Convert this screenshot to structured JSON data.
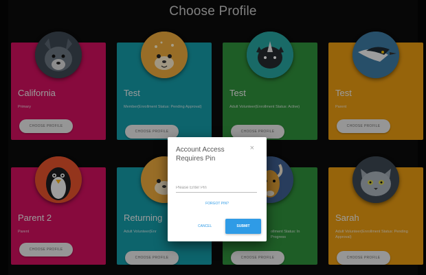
{
  "page": {
    "title": "Choose Profile"
  },
  "profiles": [
    {
      "name": "California",
      "role": "Primary",
      "button": "CHOOSE PROFILE",
      "color": "#d0105e",
      "animal": "wolf-icon"
    },
    {
      "name": "Test",
      "role": "Member(Enrollment Status: Pending Approval)",
      "button": "CHOOSE PROFILE",
      "color": "#159aa6",
      "animal": "deer-icon"
    },
    {
      "name": "Test",
      "role": "Adult Volunteer(Enrollment Status: Active)",
      "button": "CHOOSE PROFILE",
      "color": "#2f8f3b",
      "animal": "rhino-icon"
    },
    {
      "name": "Test",
      "role": "Parent",
      "button": "CHOOSE PROFILE",
      "color": "#e79a12",
      "animal": "bird-icon"
    },
    {
      "name": "Parent 2",
      "role": "Parent",
      "button": "CHOOSE PROFILE",
      "color": "#d0105e",
      "animal": "penguin-icon"
    },
    {
      "name": "Returning",
      "role": "Adult Volunteer(Enr",
      "button": "CHOOSE PROFILE",
      "color": "#159aa6",
      "animal": "deer-icon"
    },
    {
      "name": "",
      "role": "ollment Status: In Progress",
      "button": "CHOOSE PROFILE",
      "color": "#2f8f3b",
      "animal": "goat-icon"
    },
    {
      "name": "Sarah",
      "role": "Adult Volunteer(Enrollment Status: Pending Approval)",
      "button": "CHOOSE PROFILE",
      "color": "#e79a12",
      "animal": "cat-icon"
    }
  ],
  "dialog": {
    "title": "Account Access Requires Pin",
    "close": "×",
    "pin_placeholder": "Please Enter Pin",
    "forgot": "FORGOT PIN?",
    "cancel": "CANCEL",
    "submit": "SUBMIT"
  }
}
